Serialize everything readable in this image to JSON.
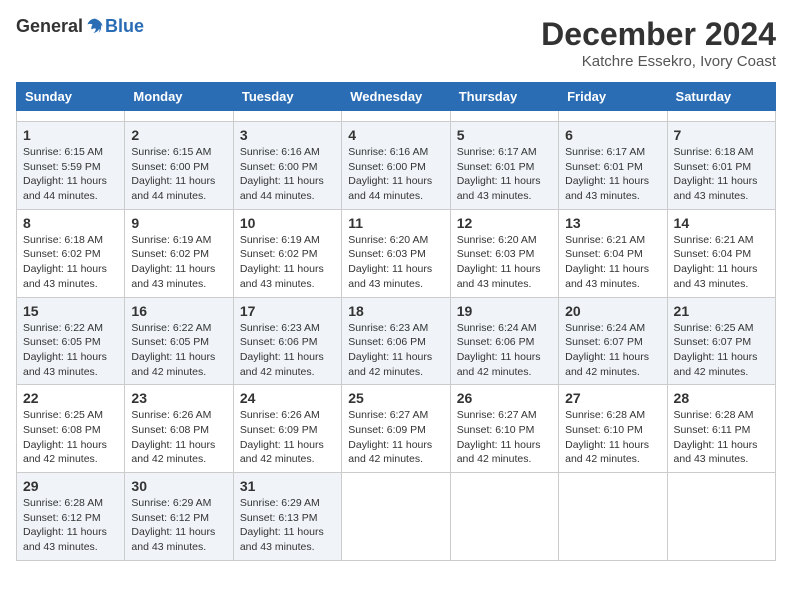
{
  "header": {
    "logo_general": "General",
    "logo_blue": "Blue",
    "month_title": "December 2024",
    "location": "Katchre Essekro, Ivory Coast"
  },
  "calendar": {
    "headers": [
      "Sunday",
      "Monday",
      "Tuesday",
      "Wednesday",
      "Thursday",
      "Friday",
      "Saturday"
    ],
    "weeks": [
      [
        {
          "day": null
        },
        {
          "day": null
        },
        {
          "day": null
        },
        {
          "day": null
        },
        {
          "day": null
        },
        {
          "day": null
        },
        {
          "day": null
        }
      ],
      [
        {
          "day": 1,
          "sunrise": "6:15 AM",
          "sunset": "5:59 PM",
          "daylight": "11 hours and 44 minutes"
        },
        {
          "day": 2,
          "sunrise": "6:15 AM",
          "sunset": "6:00 PM",
          "daylight": "11 hours and 44 minutes"
        },
        {
          "day": 3,
          "sunrise": "6:16 AM",
          "sunset": "6:00 PM",
          "daylight": "11 hours and 44 minutes"
        },
        {
          "day": 4,
          "sunrise": "6:16 AM",
          "sunset": "6:00 PM",
          "daylight": "11 hours and 44 minutes"
        },
        {
          "day": 5,
          "sunrise": "6:17 AM",
          "sunset": "6:01 PM",
          "daylight": "11 hours and 43 minutes"
        },
        {
          "day": 6,
          "sunrise": "6:17 AM",
          "sunset": "6:01 PM",
          "daylight": "11 hours and 43 minutes"
        },
        {
          "day": 7,
          "sunrise": "6:18 AM",
          "sunset": "6:01 PM",
          "daylight": "11 hours and 43 minutes"
        }
      ],
      [
        {
          "day": 8,
          "sunrise": "6:18 AM",
          "sunset": "6:02 PM",
          "daylight": "11 hours and 43 minutes"
        },
        {
          "day": 9,
          "sunrise": "6:19 AM",
          "sunset": "6:02 PM",
          "daylight": "11 hours and 43 minutes"
        },
        {
          "day": 10,
          "sunrise": "6:19 AM",
          "sunset": "6:02 PM",
          "daylight": "11 hours and 43 minutes"
        },
        {
          "day": 11,
          "sunrise": "6:20 AM",
          "sunset": "6:03 PM",
          "daylight": "11 hours and 43 minutes"
        },
        {
          "day": 12,
          "sunrise": "6:20 AM",
          "sunset": "6:03 PM",
          "daylight": "11 hours and 43 minutes"
        },
        {
          "day": 13,
          "sunrise": "6:21 AM",
          "sunset": "6:04 PM",
          "daylight": "11 hours and 43 minutes"
        },
        {
          "day": 14,
          "sunrise": "6:21 AM",
          "sunset": "6:04 PM",
          "daylight": "11 hours and 43 minutes"
        }
      ],
      [
        {
          "day": 15,
          "sunrise": "6:22 AM",
          "sunset": "6:05 PM",
          "daylight": "11 hours and 43 minutes"
        },
        {
          "day": 16,
          "sunrise": "6:22 AM",
          "sunset": "6:05 PM",
          "daylight": "11 hours and 42 minutes"
        },
        {
          "day": 17,
          "sunrise": "6:23 AM",
          "sunset": "6:06 PM",
          "daylight": "11 hours and 42 minutes"
        },
        {
          "day": 18,
          "sunrise": "6:23 AM",
          "sunset": "6:06 PM",
          "daylight": "11 hours and 42 minutes"
        },
        {
          "day": 19,
          "sunrise": "6:24 AM",
          "sunset": "6:06 PM",
          "daylight": "11 hours and 42 minutes"
        },
        {
          "day": 20,
          "sunrise": "6:24 AM",
          "sunset": "6:07 PM",
          "daylight": "11 hours and 42 minutes"
        },
        {
          "day": 21,
          "sunrise": "6:25 AM",
          "sunset": "6:07 PM",
          "daylight": "11 hours and 42 minutes"
        }
      ],
      [
        {
          "day": 22,
          "sunrise": "6:25 AM",
          "sunset": "6:08 PM",
          "daylight": "11 hours and 42 minutes"
        },
        {
          "day": 23,
          "sunrise": "6:26 AM",
          "sunset": "6:08 PM",
          "daylight": "11 hours and 42 minutes"
        },
        {
          "day": 24,
          "sunrise": "6:26 AM",
          "sunset": "6:09 PM",
          "daylight": "11 hours and 42 minutes"
        },
        {
          "day": 25,
          "sunrise": "6:27 AM",
          "sunset": "6:09 PM",
          "daylight": "11 hours and 42 minutes"
        },
        {
          "day": 26,
          "sunrise": "6:27 AM",
          "sunset": "6:10 PM",
          "daylight": "11 hours and 42 minutes"
        },
        {
          "day": 27,
          "sunrise": "6:28 AM",
          "sunset": "6:10 PM",
          "daylight": "11 hours and 42 minutes"
        },
        {
          "day": 28,
          "sunrise": "6:28 AM",
          "sunset": "6:11 PM",
          "daylight": "11 hours and 43 minutes"
        }
      ],
      [
        {
          "day": 29,
          "sunrise": "6:28 AM",
          "sunset": "6:12 PM",
          "daylight": "11 hours and 43 minutes"
        },
        {
          "day": 30,
          "sunrise": "6:29 AM",
          "sunset": "6:12 PM",
          "daylight": "11 hours and 43 minutes"
        },
        {
          "day": 31,
          "sunrise": "6:29 AM",
          "sunset": "6:13 PM",
          "daylight": "11 hours and 43 minutes"
        },
        {
          "day": null
        },
        {
          "day": null
        },
        {
          "day": null
        },
        {
          "day": null
        }
      ]
    ],
    "labels": {
      "sunrise": "Sunrise:",
      "sunset": "Sunset:",
      "daylight": "Daylight:"
    }
  }
}
